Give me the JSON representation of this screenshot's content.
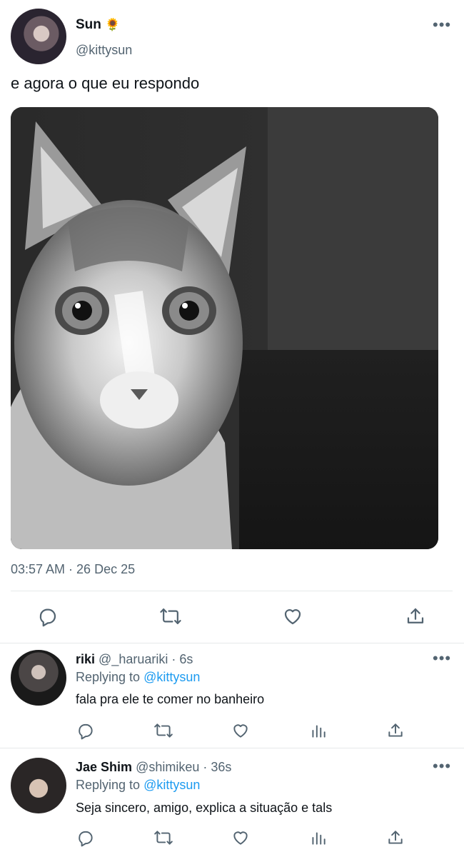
{
  "tweet": {
    "author": {
      "display_name": "Sun",
      "emoji": "🌻",
      "handle": "@kittysun"
    },
    "text": "e agora o que eu respondo",
    "timestamp": "03:57 AM · 26 Dec 25",
    "image": {
      "subject": "grayscale cat photo"
    }
  },
  "replies": [
    {
      "display_name": "riki",
      "handle": "@_haruariki",
      "time": "· 6s",
      "replying_prefix": "Replying to",
      "replying_to": "@kittysun",
      "text": "fala pra ele te comer no banheiro"
    },
    {
      "display_name": "Jae Shim",
      "handle": "@shimikeu",
      "time": "· 36s",
      "replying_prefix": "Replying to",
      "replying_to": "@kittysun",
      "text": "Seja sincero, amigo, explica a situação e tals"
    }
  ],
  "icons": {
    "more": "more-horizontal-icon",
    "reply": "reply-icon",
    "retweet": "retweet-icon",
    "like": "heart-icon",
    "share": "share-icon",
    "analytics": "analytics-icon"
  },
  "colors": {
    "accent": "#1d9bf0",
    "secondary_text": "#536471",
    "divider": "#e6e9ea"
  }
}
